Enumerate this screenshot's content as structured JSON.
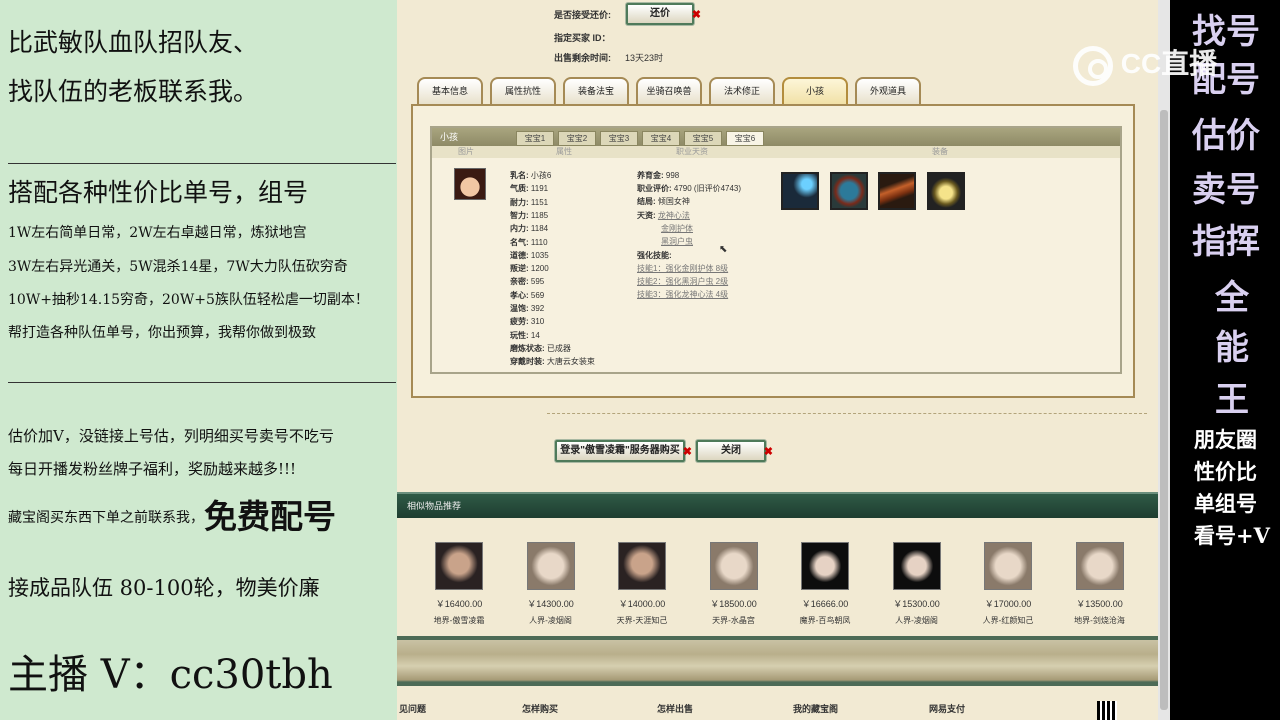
{
  "left_ad": {
    "line1": "比武敏队血队招队友、",
    "line2": "找队伍的老板联系我。",
    "line3": "搭配各种性价比单号，组号",
    "line4": "1W左右简单日常，2W左右卓越日常，炼狱地宫",
    "line5": "3W左右异光通关，5W混杀14星，7W大力队伍砍穷奇",
    "line6": "10W+抽秒14.15穷奇，20W+5族队伍轻松虐一切副本！",
    "line7": "帮打造各种队伍单号，你出预算，我帮你做到极致",
    "line8": "估价加V，没链接上号估，列明细买号卖号不吃亏",
    "line9": "每日开播发粉丝牌子福利，奖励越来越多!!!",
    "line10_pre": "藏宝阁买东西下单之前联系我，",
    "line10_big": "免费配号",
    "line11": "接成品队伍 80-100轮，物美价廉",
    "line12": "主播 V：cc30tbh"
  },
  "right_ad": {
    "big": [
      "找号",
      "配号",
      "估价",
      "卖号",
      "指挥",
      "全",
      "能",
      "王"
    ],
    "small": [
      "朋友圈",
      "性价比",
      "单组号",
      "看号+V"
    ]
  },
  "watermark": "CC直播",
  "trade": {
    "accept_label": "是否接受还价:",
    "counter_btn": "还价",
    "buyer_label": "指定买家 ID：",
    "time_label": "出售剩余时间:",
    "time_value": "13天23时"
  },
  "tabs": [
    "基本信息",
    "属性抗性",
    "装备法宝",
    "坐骑召唤兽",
    "法术修正",
    "小孩",
    "外观道具"
  ],
  "child_panel": {
    "title": "小孩",
    "subtabs": [
      "宝宝1",
      "宝宝2",
      "宝宝3",
      "宝宝4",
      "宝宝5",
      "宝宝6"
    ],
    "cols": [
      "图片",
      "属性",
      "职业天资",
      "装备"
    ],
    "stats": [
      {
        "k": "乳名:",
        "v": "小孩6"
      },
      {
        "k": "气质:",
        "v": "1191"
      },
      {
        "k": "耐力:",
        "v": "1151"
      },
      {
        "k": "智力:",
        "v": "1185"
      },
      {
        "k": "内力:",
        "v": "1184"
      },
      {
        "k": "名气:",
        "v": "1110"
      },
      {
        "k": "道德:",
        "v": "1035"
      },
      {
        "k": "叛逆:",
        "v": "1200"
      },
      {
        "k": "亲密:",
        "v": "595"
      },
      {
        "k": "孝心:",
        "v": "569"
      },
      {
        "k": "温饱:",
        "v": "392"
      },
      {
        "k": "疲劳:",
        "v": "310"
      },
      {
        "k": "玩性:",
        "v": "14"
      },
      {
        "k": "磨炼状态:",
        "v": "已成器"
      },
      {
        "k": "穿戴时装:",
        "v": "大唐云女装束"
      }
    ],
    "prof": {
      "fund_k": "养育金:",
      "fund_v": "998",
      "eval_k": "职业评价:",
      "eval_v": "4790 (旧评价4743)",
      "end_k": "结局:",
      "end_v": "倾国女神",
      "talent_k": "天资:",
      "talents": [
        "龙神心法",
        "金刚护体",
        "黑洞户虫"
      ],
      "skill_k": "强化技能:",
      "skills": [
        "技能1：强化金刚护体 8级",
        "技能2：强化黑洞户虫 2级",
        "技能3：强化龙神心法 4级"
      ]
    }
  },
  "buttons": {
    "login": "登录\"傲雪凌霜\"服务器购买",
    "close": "关闭"
  },
  "similar": {
    "title": "相似物品推荐",
    "items": [
      {
        "price": "￥16400.00",
        "name": "地界-傲雪凌霜"
      },
      {
        "price": "￥14300.00",
        "name": "人界-凌烟阁"
      },
      {
        "price": "￥14000.00",
        "name": "天界-天涯知己"
      },
      {
        "price": "￥18500.00",
        "name": "天界-水晶宫"
      },
      {
        "price": "￥16666.00",
        "name": "魔界-百鸟朝凤"
      },
      {
        "price": "￥15300.00",
        "name": "人界-凌烟阁"
      },
      {
        "price": "￥17000.00",
        "name": "人界-红颜知己"
      },
      {
        "price": "￥13500.00",
        "name": "地界-剑烧沧海"
      }
    ]
  },
  "footer": [
    "见问题",
    "怎样购买",
    "怎样出售",
    "我的藏宝阁",
    "网易支付"
  ],
  "colors": {
    "left_bg": "#cfe9cf",
    "page_bg": "#f2ead3",
    "nav_green": "#2f5a46",
    "right_text": "#d9d0f0"
  }
}
